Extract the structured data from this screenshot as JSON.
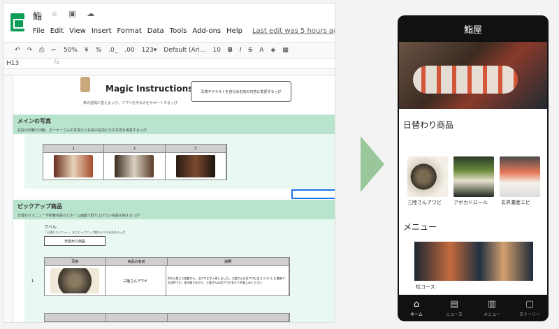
{
  "spreadsheet": {
    "title": "鮨",
    "menu": [
      "File",
      "Edit",
      "View",
      "Insert",
      "Format",
      "Data",
      "Tools",
      "Add-ons",
      "Help"
    ],
    "last_edit": "Last edit was 5 hours ago",
    "toolbar": {
      "zoom": "50%",
      "currency": "¥",
      "percent": "%",
      "dec_less": ".0_",
      ".dec_more": ".00",
      "format": "123▾",
      "font": "Default (Ari...",
      "font_size": "10",
      "bold": "B",
      "italic": "I",
      "strike": "S",
      "text_color": "A"
    },
    "cell_ref": "H13",
    "fx": "fx",
    "banner": {
      "title": "Magic Instructions",
      "subtitle": "表の説明に答えるっぴ、アプリを作るのをサポートするっぴ",
      "bubble": "写真やテキストを自分のお店の内容に変更するっぴ"
    },
    "section_main": {
      "label": "メインの写真",
      "desc": "お店の外観や内観、オーナーさんの写真などお店の名前となる写真を用意するっぴ",
      "columns": [
        "1",
        "2",
        "3"
      ]
    },
    "section_pickup": {
      "label": "ピックアップ商品",
      "desc": "日替わりメニューや新着商品などホーム画面で取り上げたい商品を揃えるっぴ",
      "field_label": "ラベル",
      "field_hint": "「日替わりメニュー」などピックアップ欄のラベルを決めるっぴ",
      "field_value": "日替わり商品",
      "table_headers": [
        "写真",
        "商品の名前",
        "説明"
      ],
      "row_num": "1",
      "row_name": "三陸さんアワビ",
      "row_desc": "今から魚に三陸産から、活アワビが入荷しました。三陸さんの活アワビはコリコリした食感で大好評です。本日限りなので、三陸さんの活アワビをどうぞ楽しみください"
    }
  },
  "phone": {
    "title": "鮨屋",
    "section_daily": "日替わり商品",
    "items": [
      {
        "label": "三陸さんアワビ"
      },
      {
        "label": "アボカドロール"
      },
      {
        "label": "玄界灘産エビ"
      }
    ],
    "section_menu": "メニュー",
    "course_label": "松コース",
    "nav": [
      {
        "icon": "home-icon",
        "label": "ホーム"
      },
      {
        "icon": "news-icon",
        "label": "ニュース"
      },
      {
        "icon": "menu-icon",
        "label": "メニュー"
      },
      {
        "icon": "story-icon",
        "label": "ストーリー"
      }
    ]
  },
  "colors": {
    "band": "#b8e3cd",
    "panel": "#e9f8f0",
    "arrow": "#9ac79a",
    "phone_bg": "#111111",
    "selection": "#1a73e8"
  }
}
